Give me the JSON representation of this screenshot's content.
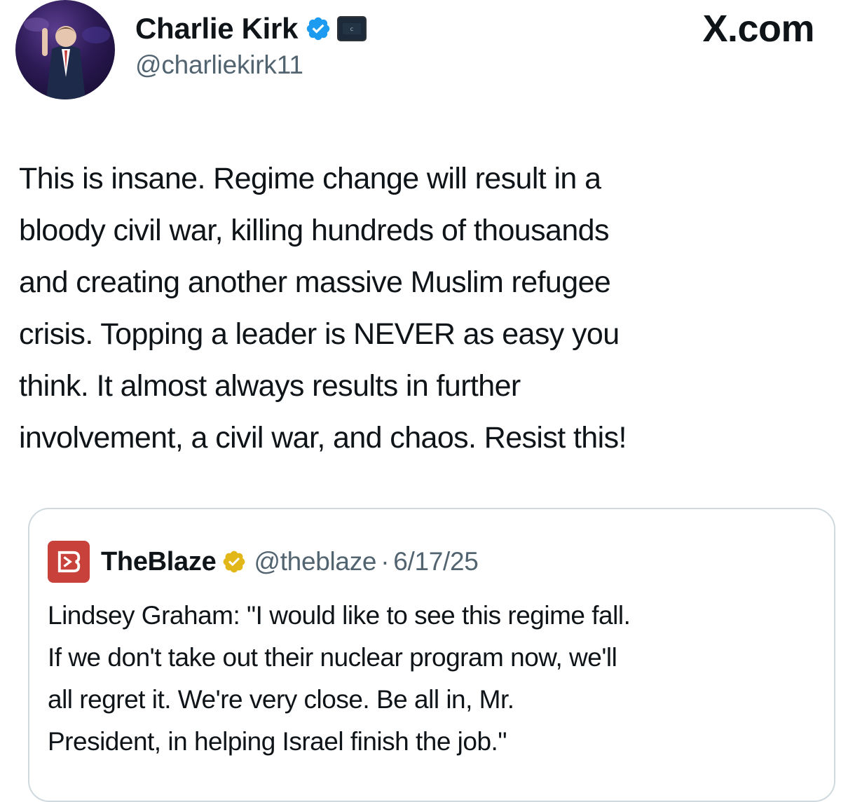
{
  "site": {
    "label": "X.com"
  },
  "author": {
    "display_name": "Charlie Kirk",
    "handle": "@charliekirk11",
    "verified_icon": "blue-verified-badge-icon",
    "affiliate_icon": "affiliate-badge-icon"
  },
  "tweet": {
    "text": "This is insane. Regime change will result in a\nbloody civil war, killing hundreds of thousands\nand creating another massive Muslim refugee\ncrisis. Topping a leader is NEVER as easy you\nthink. It almost always results in further\ninvolvement, a civil war, and chaos. Resist this!"
  },
  "quoted": {
    "logo_icon": "theblaze-logo-icon",
    "display_name": "TheBlaze",
    "verified_icon": "gold-verified-badge-icon",
    "handle": "@theblaze",
    "separator": "·",
    "date": "6/17/25",
    "text": "Lindsey Graham: \"I would like to see this regime fall.\nIf we don't take out their nuclear program now, we'll\nall regret it. We're very close. Be all in, Mr.\nPresident, in helping Israel finish the job.\""
  },
  "colors": {
    "text": "#0f1419",
    "secondary": "#536471",
    "border": "#cfd9de",
    "verified_blue": "#1d9bf0",
    "verified_gold": "#e2b719",
    "blaze_red": "#c8413a"
  }
}
